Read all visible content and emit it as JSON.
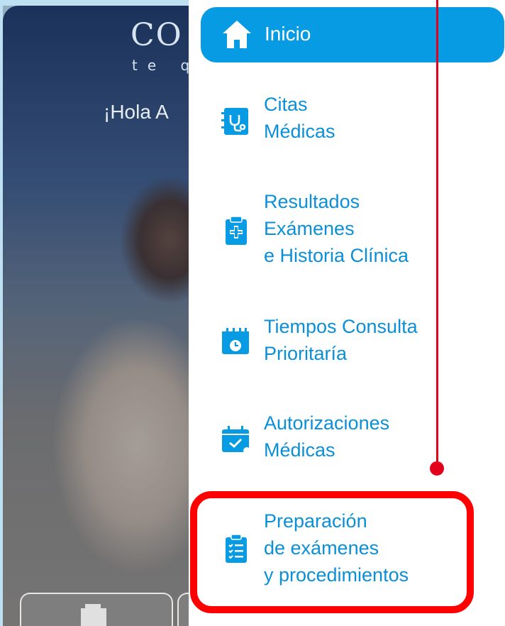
{
  "background": {
    "brand": "CO",
    "brand_sub": "te q",
    "greeting": "¡Hola A"
  },
  "menu": {
    "active": {
      "label": "Inicio",
      "icon": "home-icon"
    },
    "items": [
      {
        "lines": [
          "Citas",
          "Médicas"
        ],
        "icon": "stethoscope-clipboard-icon"
      },
      {
        "lines": [
          "Resultados",
          "Exámenes",
          "e Historia Clínica"
        ],
        "icon": "medical-clipboard-icon"
      },
      {
        "lines": [
          "Tiempos Consulta",
          "Prioritaría"
        ],
        "icon": "calendar-clock-icon"
      },
      {
        "lines": [
          "Autorizaciones",
          "Médicas"
        ],
        "icon": "calendar-check-icon"
      },
      {
        "lines": [
          "Preparación",
          "de exámenes",
          "y procedimientos"
        ],
        "icon": "checklist-clipboard-icon"
      }
    ]
  },
  "colors": {
    "accent": "#069be2",
    "text": "#0a8fd8",
    "annotation": "#e2001a",
    "highlight": "#ff0000"
  }
}
